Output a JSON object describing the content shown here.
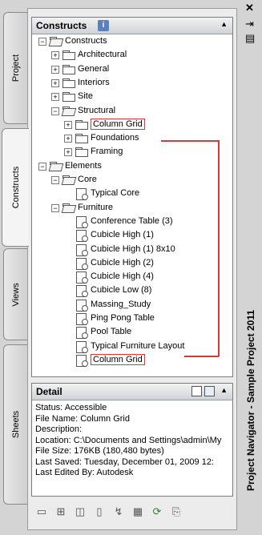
{
  "tabs": [
    "Project",
    "Constructs",
    "Views",
    "Sheets"
  ],
  "constructs_panel": {
    "title": "Constructs",
    "tree": [
      {
        "label": "Constructs",
        "icon": "open-folder-icon",
        "expander": "−"
      },
      {
        "label": "Architectural",
        "icon": "folder-icon",
        "expander": "+"
      },
      {
        "label": "General",
        "icon": "folder-icon",
        "expander": "+"
      },
      {
        "label": "Interiors",
        "icon": "folder-icon",
        "expander": "+"
      },
      {
        "label": "Site",
        "icon": "folder-icon",
        "expander": "+"
      },
      {
        "label": "Structural",
        "icon": "open-folder-icon",
        "expander": "−"
      },
      {
        "label": "Column Grid",
        "icon": "folder-icon",
        "expander": "+"
      },
      {
        "label": "Foundations",
        "icon": "folder-icon",
        "expander": "+"
      },
      {
        "label": "Framing",
        "icon": "folder-icon",
        "expander": "+"
      },
      {
        "label": "Elements",
        "icon": "open-folder-icon",
        "expander": "−"
      },
      {
        "label": "Core",
        "icon": "open-folder-icon",
        "expander": "−"
      },
      {
        "label": "Typical Core",
        "icon": "element-icon",
        "expander": ""
      },
      {
        "label": "Furniture",
        "icon": "open-folder-icon",
        "expander": "−"
      },
      {
        "label": "Conference Table (3)",
        "icon": "element-icon",
        "expander": ""
      },
      {
        "label": "Cubicle High (1)",
        "icon": "element-icon",
        "expander": ""
      },
      {
        "label": "Cubicle High (1) 8x10",
        "icon": "element-icon",
        "expander": ""
      },
      {
        "label": "Cubicle High (2)",
        "icon": "element-icon",
        "expander": ""
      },
      {
        "label": "Cubicle High (4)",
        "icon": "element-icon",
        "expander": ""
      },
      {
        "label": "Cubicle Low (8)",
        "icon": "element-icon",
        "expander": ""
      },
      {
        "label": "Massing_Study",
        "icon": "element-icon",
        "expander": ""
      },
      {
        "label": "Ping Pong Table",
        "icon": "element-icon",
        "expander": ""
      },
      {
        "label": "Pool Table",
        "icon": "element-icon",
        "expander": ""
      },
      {
        "label": "Typical Furniture Layout",
        "icon": "element-icon",
        "expander": ""
      },
      {
        "label": "Column Grid",
        "icon": "element-icon",
        "expander": ""
      }
    ]
  },
  "detail": {
    "title": "Detail",
    "lines": [
      "Status: Accessible",
      "File Name: Column Grid",
      "Description:",
      "Location: C:\\Documents and Settings\\admin\\My",
      "File Size: 176KB (180,480 bytes)",
      "Last Saved: Tuesday, December 01, 2009  12:",
      "Last Edited By: Autodesk"
    ]
  },
  "palette_title": "Project Navigator - Sample Project 2011",
  "highlight_color": "#d23b3b"
}
